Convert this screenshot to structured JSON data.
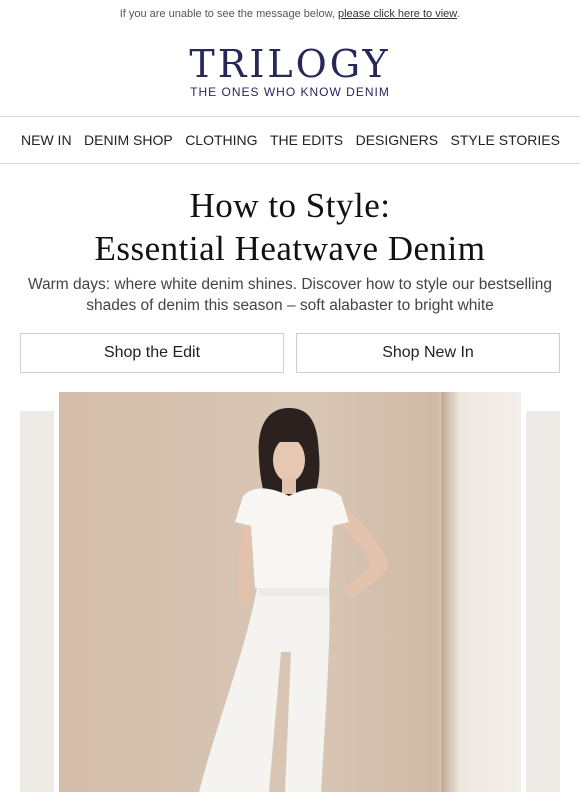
{
  "preheader": {
    "text": "If you are unable to see the message below,",
    "link": "please click here to view",
    "period": "."
  },
  "brand": {
    "logo": "TRILOGY",
    "tagline": "THE ONES WHO KNOW DENIM",
    "color": "#27285a"
  },
  "nav": {
    "items": [
      "NEW IN",
      "DENIM SHOP",
      "CLOTHING",
      "THE EDITS",
      "DESIGNERS",
      "STYLE STORIES"
    ]
  },
  "headline": {
    "line1": "How to Style:",
    "line2": "Essential Heatwave Denim"
  },
  "intro": "Warm days: where white denim shines. Discover how to style our bestselling shades of denim this season – soft alabaster to bright white",
  "buttons": {
    "shop_edit": "Shop the Edit",
    "shop_new": "Shop New In"
  }
}
